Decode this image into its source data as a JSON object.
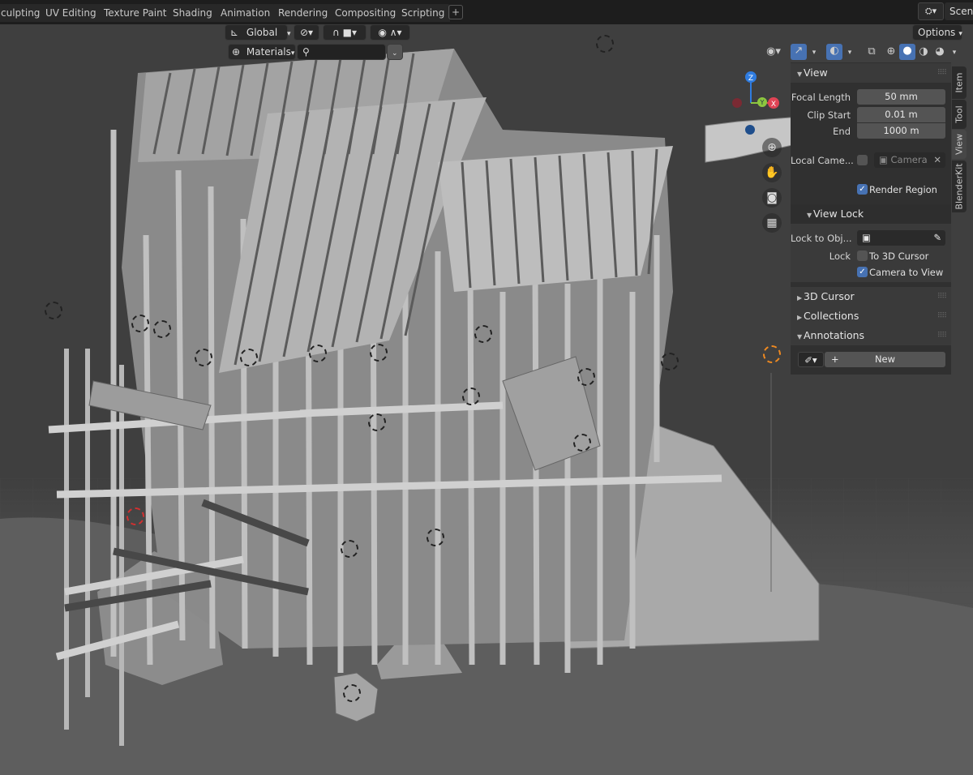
{
  "workspaces": [
    "culpting",
    "UV Editing",
    "Texture Paint",
    "Shading",
    "Animation",
    "Rendering",
    "Compositing",
    "Scripting"
  ],
  "add_workspace": "+",
  "scene": {
    "name": "Scene"
  },
  "header": {
    "transform_orientation": "Global",
    "shading_preview": "Materials",
    "options": "Options"
  },
  "npanel": {
    "tabs": [
      "Item",
      "Tool",
      "View",
      "BlenderKit"
    ],
    "view": {
      "title": "View",
      "focal_length_label": "Focal Length",
      "focal_length": "50 mm",
      "clip_start_label": "Clip Start",
      "clip_start": "0.01 m",
      "end_label": "End",
      "clip_end": "1000 m",
      "local_camera_label": "Local Came...",
      "local_camera_value": "Camera",
      "render_region_label": "Render Region"
    },
    "view_lock": {
      "title": "View Lock",
      "lock_to_object_label": "Lock to Obj...",
      "lock_label": "Lock",
      "to_3d_cursor": "To 3D Cursor",
      "camera_to_view": "Camera to View"
    },
    "sections": [
      "3D Cursor",
      "Collections",
      "Annotations"
    ],
    "annotations": {
      "new_label": "New"
    }
  },
  "gizmo": {
    "z": "Z",
    "x": "X",
    "y": "Y"
  },
  "colors": {
    "accent_blue": "#4772b3",
    "axis_x": "#e04455",
    "axis_y": "#8cc63f",
    "axis_z": "#2f7ce0",
    "bg_dark": "#1d1d1d",
    "panel": "#303030"
  }
}
